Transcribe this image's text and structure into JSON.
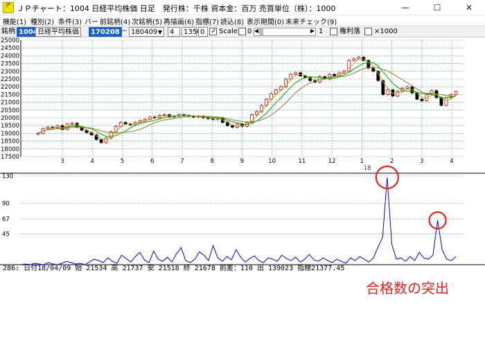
{
  "window": {
    "title": "ＪＰチャート：1004 日経平均株価 日足　発行株：千株 資本金：百万 売買単位（株）：1000",
    "app_icon_text": "JP",
    "minimize_glyph": "—",
    "maximize_glyph": "☐",
    "close_glyph": "✕"
  },
  "menu": {
    "items": [
      "機能(1)",
      "種別(2)",
      "条件(3)",
      "バー",
      "前銘柄(4)",
      "次銘柄(5)",
      "再描画(6)",
      "指標(7)",
      "読込(8)",
      "表示期間(0)",
      "未来チェック(9)"
    ]
  },
  "toolbar": {
    "label_meigara": "銘柄",
    "code": "1004",
    "name": "日経平均株価",
    "date_from": "170208",
    "dash": "－",
    "date_to": "180409",
    "period": "4",
    "bars": "1350",
    "offset": "0",
    "scale_label": "Scale",
    "scale_value": "0",
    "slider_value": "1",
    "kenri_label": "権利落",
    "x1000_label": "×1000"
  },
  "chart_data": [
    {
      "type": "line",
      "subtype": "candlestick",
      "x_tick_labels": [
        "3",
        "4",
        "5",
        "6",
        "7",
        "8",
        "9",
        "10",
        "11",
        "12",
        "1",
        "2",
        "3",
        "4"
      ],
      "x_year_label": "18",
      "y_tick_labels": [
        "25000",
        "24500",
        "24000",
        "23500",
        "23000",
        "22500",
        "22000",
        "21500",
        "21000",
        "20500",
        "20000",
        "19500",
        "19000",
        "18500",
        "18000",
        "17500"
      ],
      "ylim": [
        17500,
        25000
      ],
      "grid": true,
      "colors": {
        "up": "#e00000",
        "down": "#000000",
        "ma_short": "#c8a000",
        "ma_mid": "#00a000",
        "ma_long": "#808040"
      },
      "series": [
        {
          "values": [
            19000,
            19300,
            19400,
            19350,
            19500,
            19250,
            19600,
            19650,
            19400,
            19200,
            19050,
            18900,
            18600,
            18400,
            18700,
            19100,
            19450,
            19700,
            19600,
            19550,
            19700,
            19800,
            19900,
            20050,
            20000,
            20150,
            20200,
            20050,
            20100,
            20200,
            20150,
            20100,
            20050,
            20100,
            20000,
            19950,
            19900,
            20000,
            19700,
            19500,
            19400,
            19600,
            19450,
            19700,
            20200,
            20400,
            20800,
            21200,
            21550,
            21800,
            22000,
            22500,
            22800,
            22900,
            22700,
            22600,
            22400,
            22300,
            22650,
            22500,
            22800,
            22700,
            22900,
            23000,
            23700,
            23800,
            23900,
            23700,
            23200,
            23000,
            22400,
            21500,
            21800,
            21400,
            21700,
            21900,
            22000,
            21600,
            21200,
            21100,
            21500,
            21750,
            21300,
            20800,
            21300,
            21500,
            21678
          ]
        }
      ]
    },
    {
      "type": "line",
      "y_tick_labels": [
        "130",
        "90",
        "67",
        "45"
      ],
      "ylim": [
        0,
        130
      ],
      "grid": true,
      "colors": {
        "line": "#0000e0"
      },
      "highlights": [
        {
          "index": 80,
          "value": 128
        },
        {
          "index": 91,
          "value": 65
        }
      ],
      "series": [
        {
          "values": [
            0,
            1,
            0,
            2,
            1,
            0,
            3,
            1,
            0,
            2,
            5,
            3,
            1,
            2,
            0,
            4,
            8,
            6,
            3,
            10,
            5,
            2,
            14,
            9,
            4,
            12,
            18,
            7,
            3,
            20,
            8,
            5,
            11,
            4,
            16,
            25,
            6,
            3,
            8,
            19,
            14,
            6,
            28,
            10,
            5,
            12,
            7,
            22,
            11,
            4,
            9,
            13,
            6,
            3,
            10,
            8,
            5,
            14,
            9,
            6,
            11,
            4,
            8,
            15,
            7,
            5,
            10,
            6,
            3,
            8,
            5,
            2,
            10,
            6,
            12,
            8,
            4,
            10,
            26,
            40,
            128,
            30,
            8,
            10,
            5,
            12,
            6,
            18,
            10,
            8,
            14,
            65,
            22,
            8,
            6,
            12
          ]
        }
      ]
    }
  ],
  "status": {
    "text": "286:  日付18/04/09  始 21534  高 21737  安 21518  終 21678 前差：110  出 139023  指標21377.45"
  },
  "annotation": {
    "text": "合格数の突出",
    "color": "#e82020"
  }
}
